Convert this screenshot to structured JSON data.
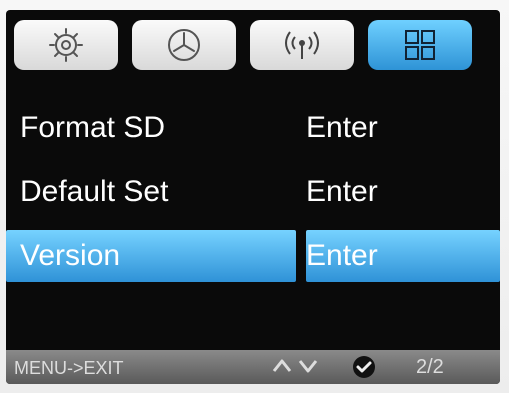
{
  "tabs": [
    {
      "icon": "gear-icon",
      "active": false
    },
    {
      "icon": "clock-icon",
      "active": false
    },
    {
      "icon": "wireless-icon",
      "active": false
    },
    {
      "icon": "grid-icon",
      "active": true
    }
  ],
  "menu": {
    "items": [
      {
        "label": "Format SD",
        "value": "Enter",
        "selected": false
      },
      {
        "label": "Default Set",
        "value": "Enter",
        "selected": false
      },
      {
        "label": "Version",
        "value": "Enter",
        "selected": true
      }
    ]
  },
  "footer": {
    "hint": "MENU->EXIT",
    "page": "2/2"
  },
  "colors": {
    "highlight": "#4aa6e8",
    "background": "#0a0a0a",
    "text": "#ffffff"
  }
}
